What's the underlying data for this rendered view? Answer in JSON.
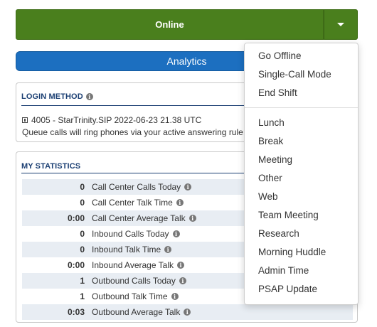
{
  "status": {
    "current": "Online"
  },
  "analytics": {
    "label": "Analytics"
  },
  "login_method": {
    "title": "LOGIN METHOD",
    "device_line": "4005 - StarTrinity.SIP 2022-06-23 21.38 UTC",
    "note": "Queue calls will ring phones via your active answering rule:"
  },
  "my_statistics": {
    "title": "MY STATISTICS",
    "rows": [
      {
        "value": "0",
        "label": "Call Center Calls Today"
      },
      {
        "value": "0",
        "label": "Call Center Talk Time"
      },
      {
        "value": "0:00",
        "label": "Call Center Average Talk"
      },
      {
        "value": "0",
        "label": "Inbound Calls Today"
      },
      {
        "value": "0",
        "label": "Inbound Talk Time"
      },
      {
        "value": "0:00",
        "label": "Inbound Average Talk"
      },
      {
        "value": "1",
        "label": "Outbound Calls Today"
      },
      {
        "value": "1",
        "label": "Outbound Talk Time"
      },
      {
        "value": "0:03",
        "label": "Outbound Average Talk"
      }
    ]
  },
  "status_menu": {
    "primary": [
      "Go Offline",
      "Single-Call Mode",
      "End Shift"
    ],
    "statuses": [
      "Lunch",
      "Break",
      "Meeting",
      "Other",
      "Web",
      "Team Meeting",
      "Research",
      "Morning Huddle",
      "Admin Time",
      "PSAP Update"
    ]
  },
  "colors": {
    "online_green": "#4a7f1d",
    "analytics_blue": "#1c6fc0",
    "section_title": "#1b3f73"
  }
}
